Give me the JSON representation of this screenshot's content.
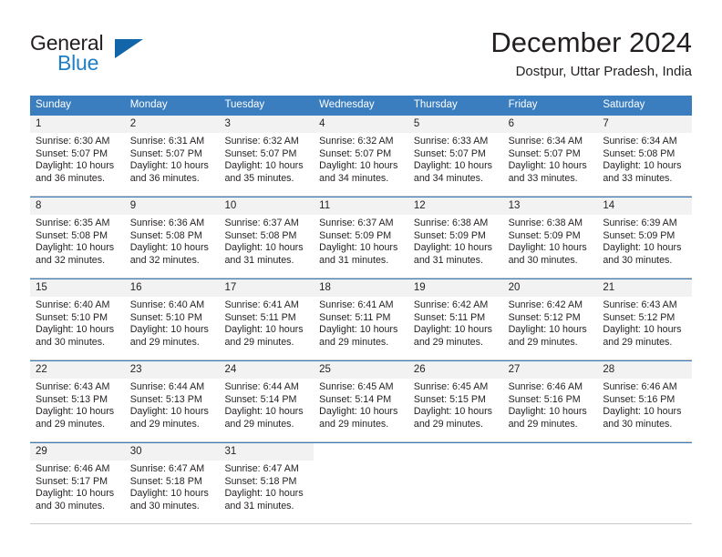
{
  "brand": {
    "name_part1": "General",
    "name_part2": "Blue",
    "triangle_color": "#1165a8",
    "blue_color": "#1f7fc4"
  },
  "header": {
    "month_title": "December 2024",
    "location": "Dostpur, Uttar Pradesh, India"
  },
  "theme": {
    "header_row_bg": "#3a7ebf",
    "header_row_text": "#ffffff",
    "daynum_bg": "#f2f2f2",
    "grid_line": "#c9c9c9",
    "text": "#231f20"
  },
  "calendar": {
    "day_names": [
      "Sunday",
      "Monday",
      "Tuesday",
      "Wednesday",
      "Thursday",
      "Friday",
      "Saturday"
    ],
    "weeks": [
      [
        {
          "day": "1",
          "sunrise": "Sunrise: 6:30 AM",
          "sunset": "Sunset: 5:07 PM",
          "daylight1": "Daylight: 10 hours",
          "daylight2": "and 36 minutes."
        },
        {
          "day": "2",
          "sunrise": "Sunrise: 6:31 AM",
          "sunset": "Sunset: 5:07 PM",
          "daylight1": "Daylight: 10 hours",
          "daylight2": "and 36 minutes."
        },
        {
          "day": "3",
          "sunrise": "Sunrise: 6:32 AM",
          "sunset": "Sunset: 5:07 PM",
          "daylight1": "Daylight: 10 hours",
          "daylight2": "and 35 minutes."
        },
        {
          "day": "4",
          "sunrise": "Sunrise: 6:32 AM",
          "sunset": "Sunset: 5:07 PM",
          "daylight1": "Daylight: 10 hours",
          "daylight2": "and 34 minutes."
        },
        {
          "day": "5",
          "sunrise": "Sunrise: 6:33 AM",
          "sunset": "Sunset: 5:07 PM",
          "daylight1": "Daylight: 10 hours",
          "daylight2": "and 34 minutes."
        },
        {
          "day": "6",
          "sunrise": "Sunrise: 6:34 AM",
          "sunset": "Sunset: 5:07 PM",
          "daylight1": "Daylight: 10 hours",
          "daylight2": "and 33 minutes."
        },
        {
          "day": "7",
          "sunrise": "Sunrise: 6:34 AM",
          "sunset": "Sunset: 5:08 PM",
          "daylight1": "Daylight: 10 hours",
          "daylight2": "and 33 minutes."
        }
      ],
      [
        {
          "day": "8",
          "sunrise": "Sunrise: 6:35 AM",
          "sunset": "Sunset: 5:08 PM",
          "daylight1": "Daylight: 10 hours",
          "daylight2": "and 32 minutes."
        },
        {
          "day": "9",
          "sunrise": "Sunrise: 6:36 AM",
          "sunset": "Sunset: 5:08 PM",
          "daylight1": "Daylight: 10 hours",
          "daylight2": "and 32 minutes."
        },
        {
          "day": "10",
          "sunrise": "Sunrise: 6:37 AM",
          "sunset": "Sunset: 5:08 PM",
          "daylight1": "Daylight: 10 hours",
          "daylight2": "and 31 minutes."
        },
        {
          "day": "11",
          "sunrise": "Sunrise: 6:37 AM",
          "sunset": "Sunset: 5:09 PM",
          "daylight1": "Daylight: 10 hours",
          "daylight2": "and 31 minutes."
        },
        {
          "day": "12",
          "sunrise": "Sunrise: 6:38 AM",
          "sunset": "Sunset: 5:09 PM",
          "daylight1": "Daylight: 10 hours",
          "daylight2": "and 31 minutes."
        },
        {
          "day": "13",
          "sunrise": "Sunrise: 6:38 AM",
          "sunset": "Sunset: 5:09 PM",
          "daylight1": "Daylight: 10 hours",
          "daylight2": "and 30 minutes."
        },
        {
          "day": "14",
          "sunrise": "Sunrise: 6:39 AM",
          "sunset": "Sunset: 5:09 PM",
          "daylight1": "Daylight: 10 hours",
          "daylight2": "and 30 minutes."
        }
      ],
      [
        {
          "day": "15",
          "sunrise": "Sunrise: 6:40 AM",
          "sunset": "Sunset: 5:10 PM",
          "daylight1": "Daylight: 10 hours",
          "daylight2": "and 30 minutes."
        },
        {
          "day": "16",
          "sunrise": "Sunrise: 6:40 AM",
          "sunset": "Sunset: 5:10 PM",
          "daylight1": "Daylight: 10 hours",
          "daylight2": "and 29 minutes."
        },
        {
          "day": "17",
          "sunrise": "Sunrise: 6:41 AM",
          "sunset": "Sunset: 5:11 PM",
          "daylight1": "Daylight: 10 hours",
          "daylight2": "and 29 minutes."
        },
        {
          "day": "18",
          "sunrise": "Sunrise: 6:41 AM",
          "sunset": "Sunset: 5:11 PM",
          "daylight1": "Daylight: 10 hours",
          "daylight2": "and 29 minutes."
        },
        {
          "day": "19",
          "sunrise": "Sunrise: 6:42 AM",
          "sunset": "Sunset: 5:11 PM",
          "daylight1": "Daylight: 10 hours",
          "daylight2": "and 29 minutes."
        },
        {
          "day": "20",
          "sunrise": "Sunrise: 6:42 AM",
          "sunset": "Sunset: 5:12 PM",
          "daylight1": "Daylight: 10 hours",
          "daylight2": "and 29 minutes."
        },
        {
          "day": "21",
          "sunrise": "Sunrise: 6:43 AM",
          "sunset": "Sunset: 5:12 PM",
          "daylight1": "Daylight: 10 hours",
          "daylight2": "and 29 minutes."
        }
      ],
      [
        {
          "day": "22",
          "sunrise": "Sunrise: 6:43 AM",
          "sunset": "Sunset: 5:13 PM",
          "daylight1": "Daylight: 10 hours",
          "daylight2": "and 29 minutes."
        },
        {
          "day": "23",
          "sunrise": "Sunrise: 6:44 AM",
          "sunset": "Sunset: 5:13 PM",
          "daylight1": "Daylight: 10 hours",
          "daylight2": "and 29 minutes."
        },
        {
          "day": "24",
          "sunrise": "Sunrise: 6:44 AM",
          "sunset": "Sunset: 5:14 PM",
          "daylight1": "Daylight: 10 hours",
          "daylight2": "and 29 minutes."
        },
        {
          "day": "25",
          "sunrise": "Sunrise: 6:45 AM",
          "sunset": "Sunset: 5:14 PM",
          "daylight1": "Daylight: 10 hours",
          "daylight2": "and 29 minutes."
        },
        {
          "day": "26",
          "sunrise": "Sunrise: 6:45 AM",
          "sunset": "Sunset: 5:15 PM",
          "daylight1": "Daylight: 10 hours",
          "daylight2": "and 29 minutes."
        },
        {
          "day": "27",
          "sunrise": "Sunrise: 6:46 AM",
          "sunset": "Sunset: 5:16 PM",
          "daylight1": "Daylight: 10 hours",
          "daylight2": "and 29 minutes."
        },
        {
          "day": "28",
          "sunrise": "Sunrise: 6:46 AM",
          "sunset": "Sunset: 5:16 PM",
          "daylight1": "Daylight: 10 hours",
          "daylight2": "and 30 minutes."
        }
      ],
      [
        {
          "day": "29",
          "sunrise": "Sunrise: 6:46 AM",
          "sunset": "Sunset: 5:17 PM",
          "daylight1": "Daylight: 10 hours",
          "daylight2": "and 30 minutes."
        },
        {
          "day": "30",
          "sunrise": "Sunrise: 6:47 AM",
          "sunset": "Sunset: 5:18 PM",
          "daylight1": "Daylight: 10 hours",
          "daylight2": "and 30 minutes."
        },
        {
          "day": "31",
          "sunrise": "Sunrise: 6:47 AM",
          "sunset": "Sunset: 5:18 PM",
          "daylight1": "Daylight: 10 hours",
          "daylight2": "and 31 minutes."
        },
        {
          "day": "",
          "sunrise": "",
          "sunset": "",
          "daylight1": "",
          "daylight2": ""
        },
        {
          "day": "",
          "sunrise": "",
          "sunset": "",
          "daylight1": "",
          "daylight2": ""
        },
        {
          "day": "",
          "sunrise": "",
          "sunset": "",
          "daylight1": "",
          "daylight2": ""
        },
        {
          "day": "",
          "sunrise": "",
          "sunset": "",
          "daylight1": "",
          "daylight2": ""
        }
      ]
    ]
  }
}
